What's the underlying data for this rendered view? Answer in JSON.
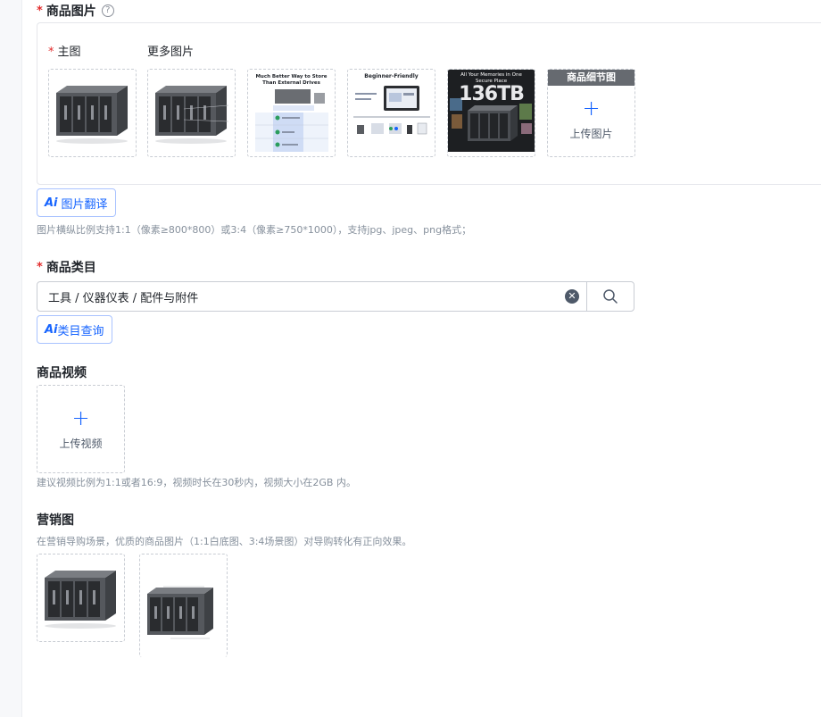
{
  "images_section": {
    "title": "商品图片",
    "required_mark": "*",
    "help_icon": "?",
    "main_label": "主图",
    "more_label": "更多图片",
    "thumb2_title": "Much Better Way to Store Than External Drives",
    "thumb3_title": "Beginner-Friendly",
    "thumb4_title": "All Your Memories in One Secure Place",
    "thumb4_big": "136TB",
    "detail_badge": "商品细节图",
    "upload_plus": "+",
    "upload_text": "上传图片",
    "ai_translate": "图片翻译",
    "ai_mark": "Ai",
    "hint": "图片横纵比例支持1:1（像素≥800*800）或3:4（像素≥750*1000），支持jpg、jpeg、png格式；"
  },
  "category_section": {
    "title": "商品类目",
    "required_mark": "*",
    "value": "工具 / 仪器仪表 / 配件与附件",
    "clear_icon": "✕",
    "ai_query": "类目查询",
    "ai_mark": "Ai"
  },
  "video_section": {
    "title": "商品视频",
    "upload_plus": "+",
    "upload_text": "上传视频",
    "hint": "建议视频比例为1:1或者16:9，视频时长在30秒内，视频大小在2GB 内。"
  },
  "marketing_section": {
    "title": "营销图",
    "hint": "在营销导购场景，优质的商品图片（1:1白底图、3:4场景图）对导购转化有正向效果。"
  },
  "colors": {
    "accent": "#1664ff",
    "required": "#e22c2c",
    "hint": "#86909c"
  }
}
